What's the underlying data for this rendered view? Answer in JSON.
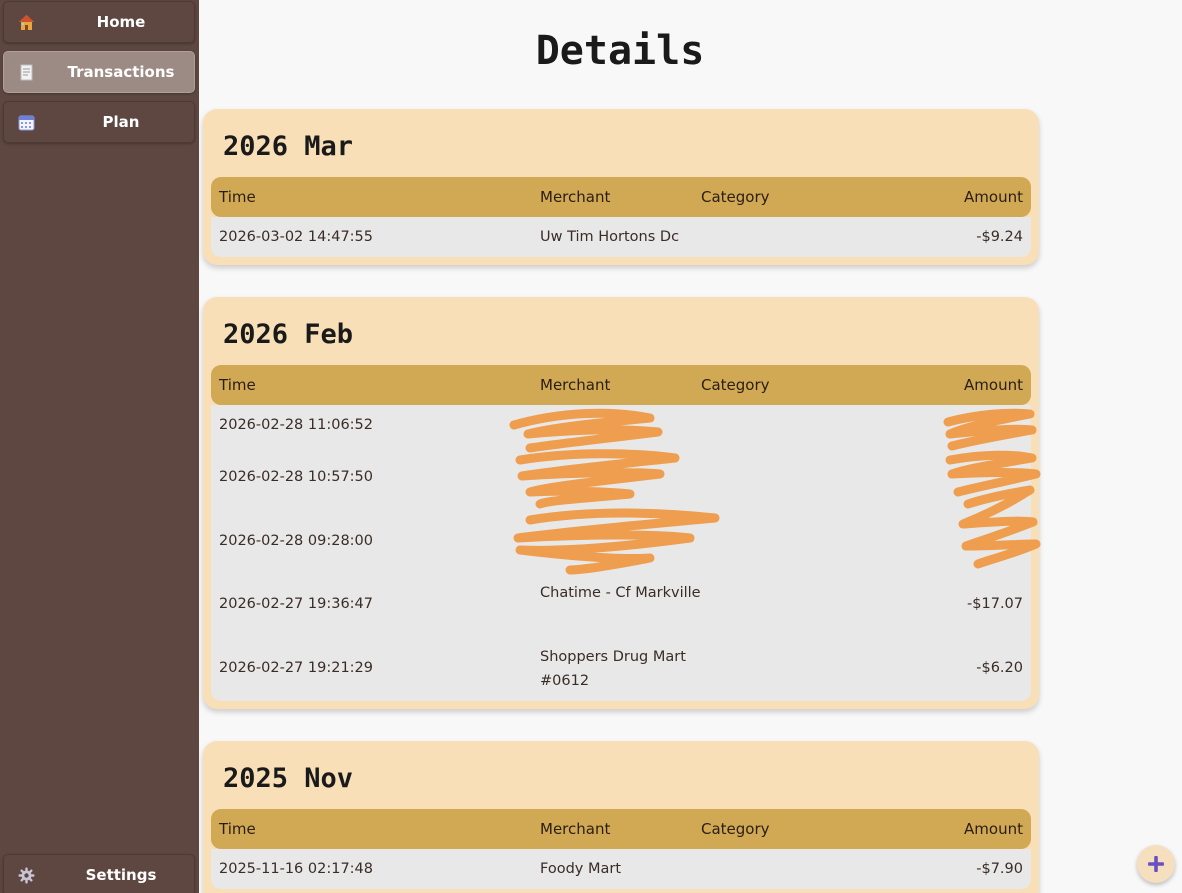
{
  "sidebar": {
    "items": [
      {
        "label": "Home",
        "icon": "house-icon",
        "active": false
      },
      {
        "label": "Transactions",
        "icon": "receipt-icon",
        "active": true
      },
      {
        "label": "Plan",
        "icon": "calendar-icon",
        "active": false
      }
    ],
    "settings": {
      "label": "Settings",
      "icon": "gear-icon"
    }
  },
  "page_title": "Details",
  "columns": {
    "time": "Time",
    "merchant": "Merchant",
    "category": "Category",
    "amount": "Amount"
  },
  "months": [
    {
      "title": "2026 Mar",
      "rows": [
        {
          "time": "2026-03-02 14:47:55",
          "merchant": "Uw Tim Hortons Dc",
          "category": "",
          "amount": "-$9.24"
        }
      ]
    },
    {
      "title": "2026 Feb",
      "rows": [
        {
          "time": "2026-02-28 11:06:52",
          "merchant": "",
          "category": "",
          "amount": "",
          "redacted": true
        },
        {
          "time": "2026-02-28 10:57:50",
          "merchant": "",
          "category": "",
          "amount": "",
          "redacted": true
        },
        {
          "time": "2026-02-28 09:28:00",
          "merchant": "",
          "category": "",
          "amount": "",
          "redacted": true
        },
        {
          "time": "2026-02-27 19:36:47",
          "merchant": "Chatime - Cf Markville",
          "category": "",
          "amount": "-$17.07"
        },
        {
          "time": "2026-02-27 19:21:29",
          "merchant": "Shoppers Drug Mart #0612",
          "category": "",
          "amount": "-$6.20"
        }
      ]
    },
    {
      "title": "2025 Nov",
      "rows": [
        {
          "time": "2025-11-16 02:17:48",
          "merchant": "Foody Mart",
          "category": "",
          "amount": "-$7.90"
        }
      ]
    }
  ],
  "fab": {
    "icon": "plus-icon"
  },
  "colors": {
    "sidebar": "#5d4740",
    "card": "#f8dfb8",
    "header": "#d1a954",
    "row": "#e8e8e8",
    "redaction": "#ee9e4e",
    "fab_plus": "#6a4fc0"
  }
}
